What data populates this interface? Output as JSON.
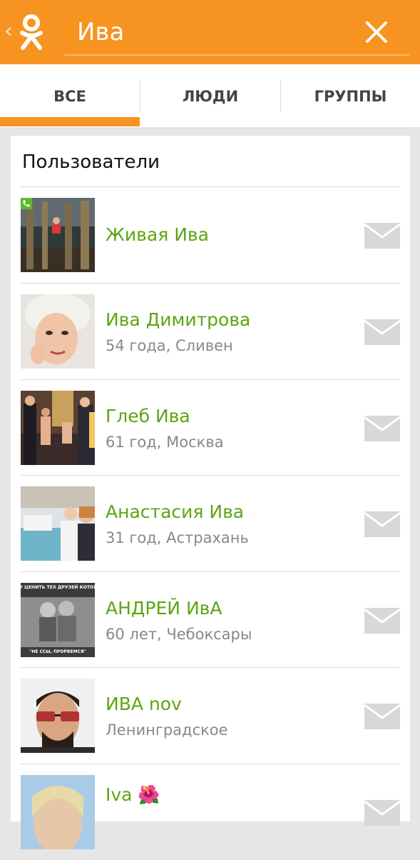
{
  "search": {
    "query": "Ива"
  },
  "tabs": [
    {
      "label": "ВСЕ"
    },
    {
      "label": "ЛЮДИ"
    },
    {
      "label": "ГРУППЫ"
    }
  ],
  "section": {
    "title": "Пользователи"
  },
  "users": [
    {
      "name": "Живая Ива",
      "meta": ""
    },
    {
      "name": "Ива Димитрова",
      "meta": "54 года, Сливен"
    },
    {
      "name": "Глеб Ива",
      "meta": "61 год, Москва"
    },
    {
      "name": "Анастасия Ива",
      "meta": "31 год, Астрахань"
    },
    {
      "name": "АНДРЕЙ ИвА",
      "meta": "60 лет, Чебоксары"
    },
    {
      "name": "ИВА nov",
      "meta": "Ленинградское"
    },
    {
      "name": "Iva 🌺",
      "meta": ""
    }
  ],
  "avatar_texts": {
    "andrey_top": "ВСЕГДА БУДУ ЦЕНИТЬ ТЕХ ДРУЗЕЙ КОТОРЫЕ СКАЖУТ",
    "andrey_bottom": "\"НЕ ССЫ, ПРОРВЕМСЯ\""
  },
  "colors": {
    "brand_orange": "#f79321",
    "name_green": "#5ca512",
    "meta_gray": "#888888"
  },
  "icons": {
    "back": "chevron-left-icon",
    "logo": "ok-logo",
    "close": "close-icon",
    "message": "envelope-icon"
  }
}
